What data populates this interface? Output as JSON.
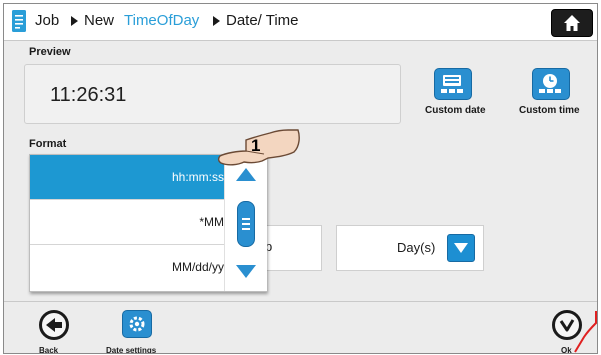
{
  "breadcrumb": {
    "job": "Job",
    "new": "New",
    "timeofday": "TimeOfDay",
    "datetime": "Date/ Time"
  },
  "preview": {
    "label": "Preview",
    "value": "11:26:31"
  },
  "quick_buttons": {
    "custom_date": "Custom date",
    "custom_time": "Custom time"
  },
  "format": {
    "label": "Format",
    "options": [
      "hh:mm:ss",
      "*MM",
      "MM/dd/yy"
    ],
    "selected_index": 0
  },
  "fields": {
    "unit_value": "Day(s)",
    "partial_value": "p"
  },
  "footer": {
    "back": "Back",
    "date_settings": "Date settings",
    "ok": "Ok"
  },
  "callout": {
    "number": "1"
  },
  "colors": {
    "accent": "#1d98d2",
    "button_blue": "#2a8fd0",
    "breadcrumb_accent": "#2a9ed8"
  }
}
